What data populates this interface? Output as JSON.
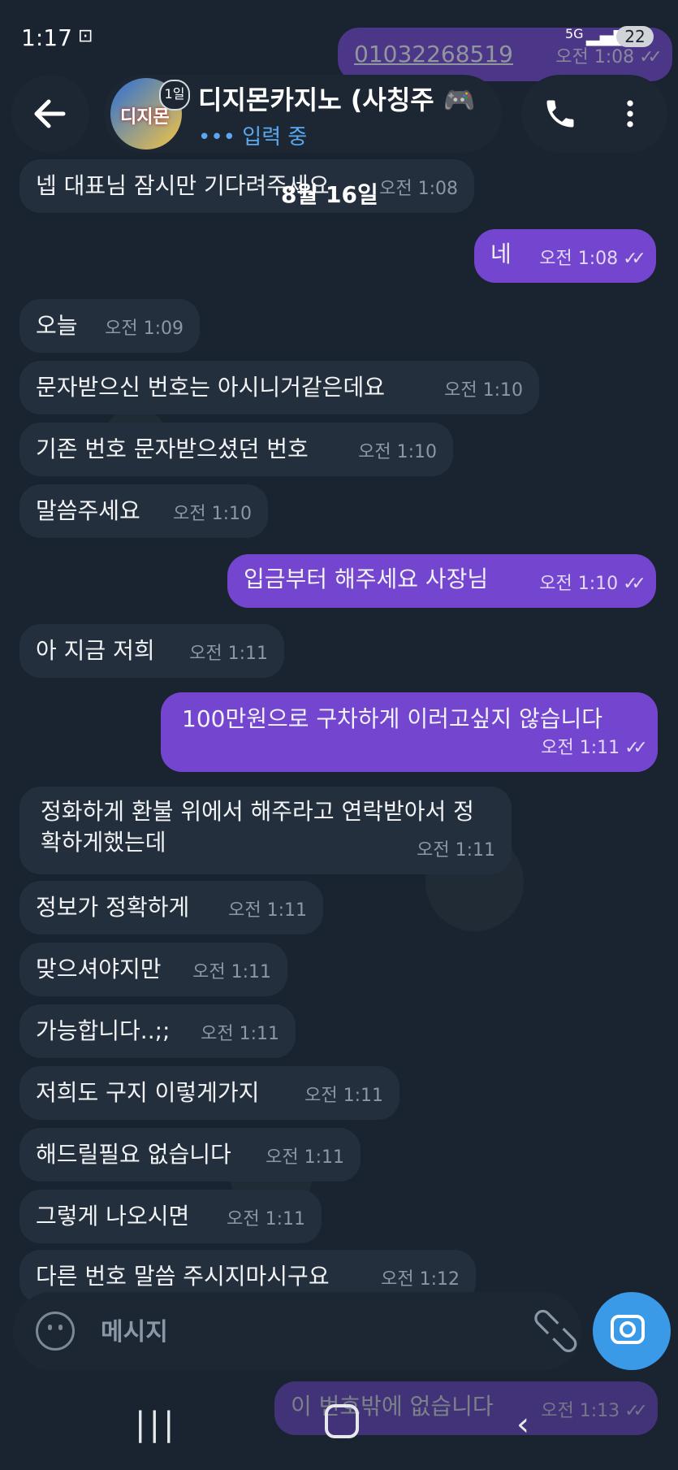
{
  "status_bar": {
    "time": "1:17",
    "network": "5G",
    "battery": "22"
  },
  "header": {
    "title": "디지몬카지노 (사칭주 🎮",
    "subtitle": "입력 중",
    "avatar_text": "디지몬",
    "rank_badge": "1일"
  },
  "date_divider": "8월 16일",
  "messages": [
    {
      "dir": "out",
      "text": "01032268519",
      "time": "오전 1:08",
      "read": true
    },
    {
      "dir": "in",
      "text": "넵 대표님 잠시만 기다려주세요",
      "time": "오전 1:08"
    },
    {
      "dir": "out",
      "text": "네",
      "time": "오전 1:08",
      "read": true
    },
    {
      "dir": "in",
      "text": "오늘",
      "time": "오전 1:09"
    },
    {
      "dir": "in",
      "text": "문자받으신 번호는 아시니거같은데요",
      "time": "오전 1:10"
    },
    {
      "dir": "in",
      "text": "기존 번호 문자받으셨던 번호",
      "time": "오전 1:10"
    },
    {
      "dir": "in",
      "text": "말씀주세요",
      "time": "오전 1:10"
    },
    {
      "dir": "out",
      "text": "입금부터 해주세요 사장님",
      "time": "오전 1:10",
      "read": true
    },
    {
      "dir": "in",
      "text": "아 지금 저희",
      "time": "오전 1:11"
    },
    {
      "dir": "out",
      "text": "100만원으로 구차하게 이러고싶지 않습니다",
      "time": "오전 1:11",
      "read": true
    },
    {
      "dir": "in",
      "text": "정화하게 환불 위에서 해주라고 연락받아서 정확하게했는데",
      "time": "오전 1:11"
    },
    {
      "dir": "in",
      "text": "정보가 정확하게",
      "time": "오전 1:11"
    },
    {
      "dir": "in",
      "text": "맞으셔야지만",
      "time": "오전 1:11"
    },
    {
      "dir": "in",
      "text": "가능합니다..;;",
      "time": "오전 1:11"
    },
    {
      "dir": "in",
      "text": "저희도 구지 이렇게가지",
      "time": "오전 1:11"
    },
    {
      "dir": "in",
      "text": "해드릴필요 없습니다",
      "time": "오전 1:11"
    },
    {
      "dir": "in",
      "text": "그렇게 나오시면",
      "time": "오전 1:11"
    },
    {
      "dir": "in",
      "text": "다른 번호 말씀 주시지마시구요",
      "time": "오전 1:12"
    },
    {
      "dir": "out",
      "text": "이 번호밖에 없습니다",
      "time": "오전 1:13",
      "read": true
    }
  ],
  "composer": {
    "placeholder": "메시지"
  },
  "icons": {
    "back": "arrow-left-icon",
    "call": "phone-icon",
    "menu": "more-vertical-icon",
    "emoji": "smile-icon",
    "attach": "paperclip-icon",
    "camera": "camera-icon"
  },
  "colors": {
    "incoming": "#242f3d",
    "outgoing": "#7445cf",
    "accent": "#3a9ae8",
    "background": "#1a2430"
  }
}
